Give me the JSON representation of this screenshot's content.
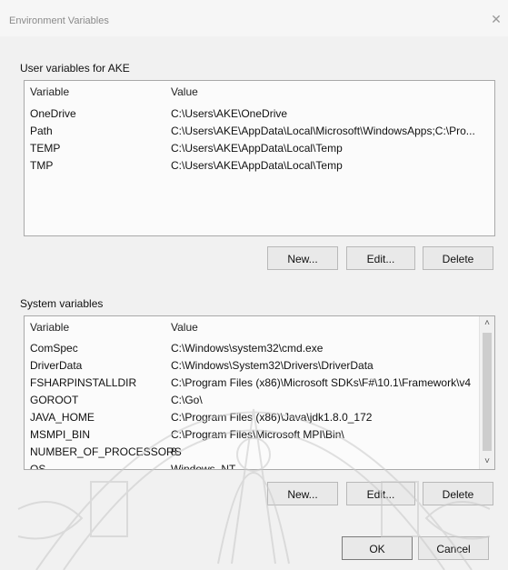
{
  "window": {
    "title": "Environment Variables",
    "close_glyph": "✕"
  },
  "user_vars": {
    "label": "User variables for AKE",
    "columns": {
      "variable": "Variable",
      "value": "Value"
    },
    "rows": [
      {
        "name": "OneDrive",
        "value": "C:\\Users\\AKE\\OneDrive"
      },
      {
        "name": "Path",
        "value": "C:\\Users\\AKE\\AppData\\Local\\Microsoft\\WindowsApps;C:\\Pro..."
      },
      {
        "name": "TEMP",
        "value": "C:\\Users\\AKE\\AppData\\Local\\Temp"
      },
      {
        "name": "TMP",
        "value": "C:\\Users\\AKE\\AppData\\Local\\Temp"
      }
    ],
    "buttons": {
      "new": "New...",
      "edit": "Edit...",
      "delete": "Delete"
    }
  },
  "system_vars": {
    "label": "System variables",
    "columns": {
      "variable": "Variable",
      "value": "Value"
    },
    "rows": [
      {
        "name": "ComSpec",
        "value": "C:\\Windows\\system32\\cmd.exe"
      },
      {
        "name": "DriverData",
        "value": "C:\\Windows\\System32\\Drivers\\DriverData"
      },
      {
        "name": "FSHARPINSTALLDIR",
        "value": "C:\\Program Files (x86)\\Microsoft SDKs\\F#\\10.1\\Framework\\v4"
      },
      {
        "name": "GOROOT",
        "value": "C:\\Go\\"
      },
      {
        "name": "JAVA_HOME",
        "value": "C:\\Program Files (x86)\\Java\\jdk1.8.0_172"
      },
      {
        "name": "MSMPI_BIN",
        "value": "C:\\Program Files\\Microsoft MPI\\Bin\\"
      },
      {
        "name": "NUMBER_OF_PROCESSORS",
        "value": "8"
      },
      {
        "name": "OS",
        "value": "Windows_NT"
      }
    ],
    "buttons": {
      "new": "New...",
      "edit": "Edit...",
      "delete": "Delete"
    }
  },
  "footer": {
    "ok": "OK",
    "cancel": "Cancel"
  },
  "scroll": {
    "up_glyph": "˄",
    "down_glyph": "˅"
  }
}
